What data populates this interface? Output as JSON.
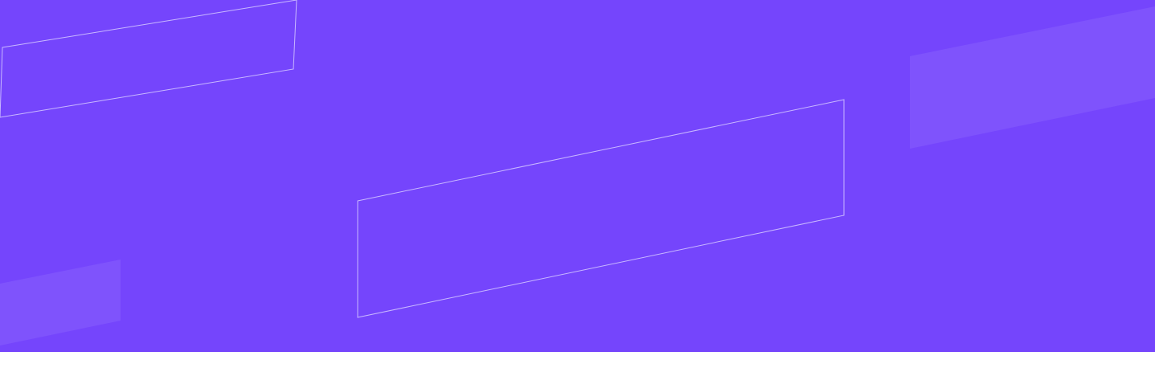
{
  "banner": {
    "background_color": "#7545fc",
    "outline_color": "#c9b8ff",
    "translucent_fill": "#ffffff"
  },
  "page": {
    "bottom_strip_color": "#ffffff"
  }
}
